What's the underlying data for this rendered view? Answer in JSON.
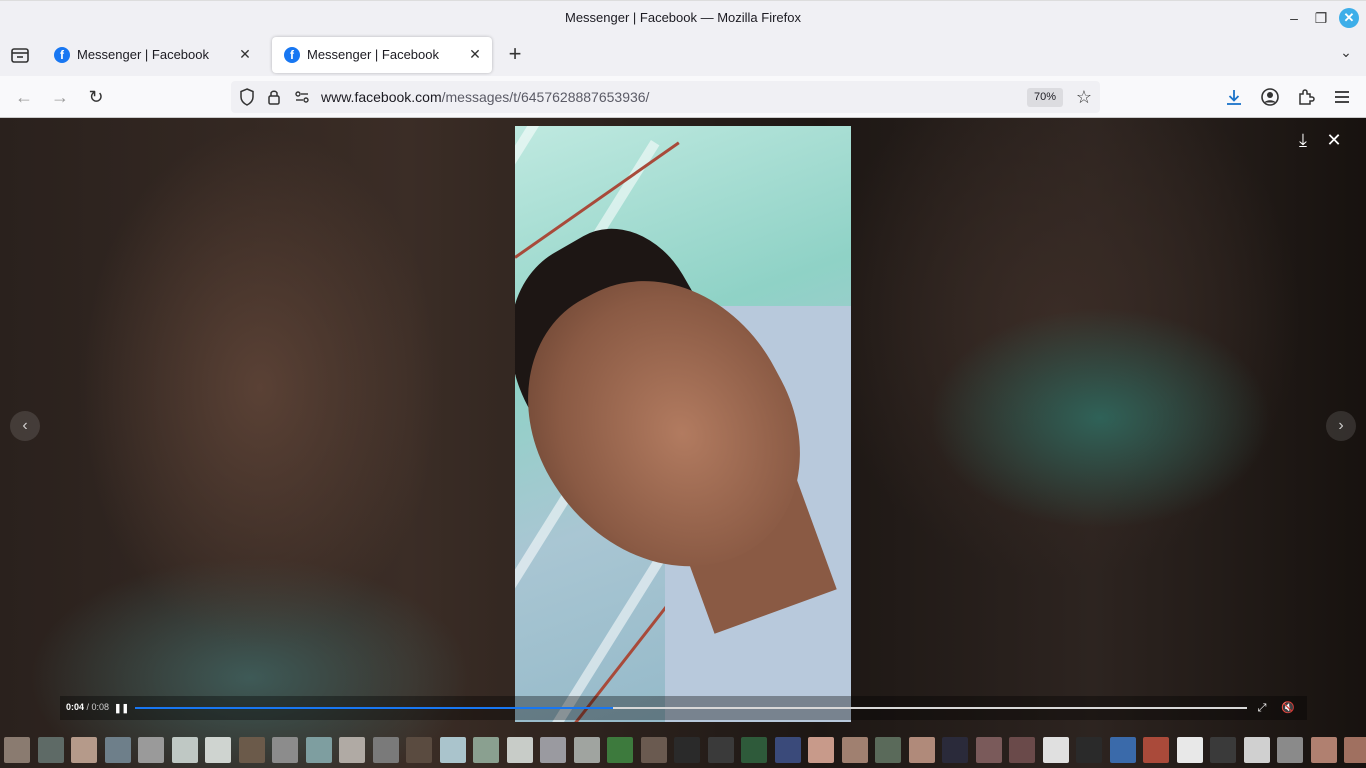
{
  "window": {
    "title": "Messenger | Facebook — Mozilla Firefox",
    "min": "–",
    "max": "❐",
    "close": "✕"
  },
  "tabs": [
    {
      "label": "Messenger | Facebook",
      "favicon": "f",
      "close": "✕",
      "active": false
    },
    {
      "label": "Messenger | Facebook",
      "favicon": "f",
      "close": "✕",
      "active": true
    }
  ],
  "tabbar": {
    "new_tab": "+",
    "list_all": "⌄"
  },
  "nav": {
    "back": "←",
    "forward": "→",
    "reload": "↻",
    "url_host": "www.facebook.com",
    "url_path": "/messages/t/6457628887653936/",
    "zoom": "70%",
    "bookmark_star": "☆"
  },
  "toolbar": {
    "download": "⤓",
    "account": "◉",
    "extensions": "✚",
    "menu": "≡"
  },
  "viewer": {
    "download": "⤓",
    "close": "✕",
    "prev": "‹",
    "next": "›",
    "current_time": "0:04",
    "separator": " / ",
    "duration": "0:08",
    "progress_fraction": 0.43,
    "pause": "❚❚",
    "fullscreen": "⤢",
    "volume": "🔇"
  },
  "thumbnail_colors": [
    "#8a7b70",
    "#5e6a66",
    "#b59a8a",
    "#6e7f8a",
    "#9a9a9a",
    "#bfc8c4",
    "#cfd4d0",
    "#6b5a4a",
    "#8c8c8c",
    "#7e9ea0",
    "#b0aaa4",
    "#7a7a7a",
    "#5a4b40",
    "#aac4cc",
    "#8aa090",
    "#c8ccc8",
    "#9a9aa0",
    "#a0a4a0",
    "#3d7a3d",
    "#6a5a50",
    "#2a2a2a",
    "#3a3a3a",
    "#2e5a3a",
    "#3a4a7a",
    "#c89a8a",
    "#a08070",
    "#5a6a5a",
    "#b08a7a",
    "#2a2a3a",
    "#7a5a5a",
    "#6a4a4a",
    "#e0e0e0",
    "#2a2a2a",
    "#3a6aaa",
    "#aa4a3a",
    "#e8e8e8",
    "#3a3a3a",
    "#d0d0d0",
    "#8a8a8a",
    "#b08070",
    "#a07060"
  ]
}
